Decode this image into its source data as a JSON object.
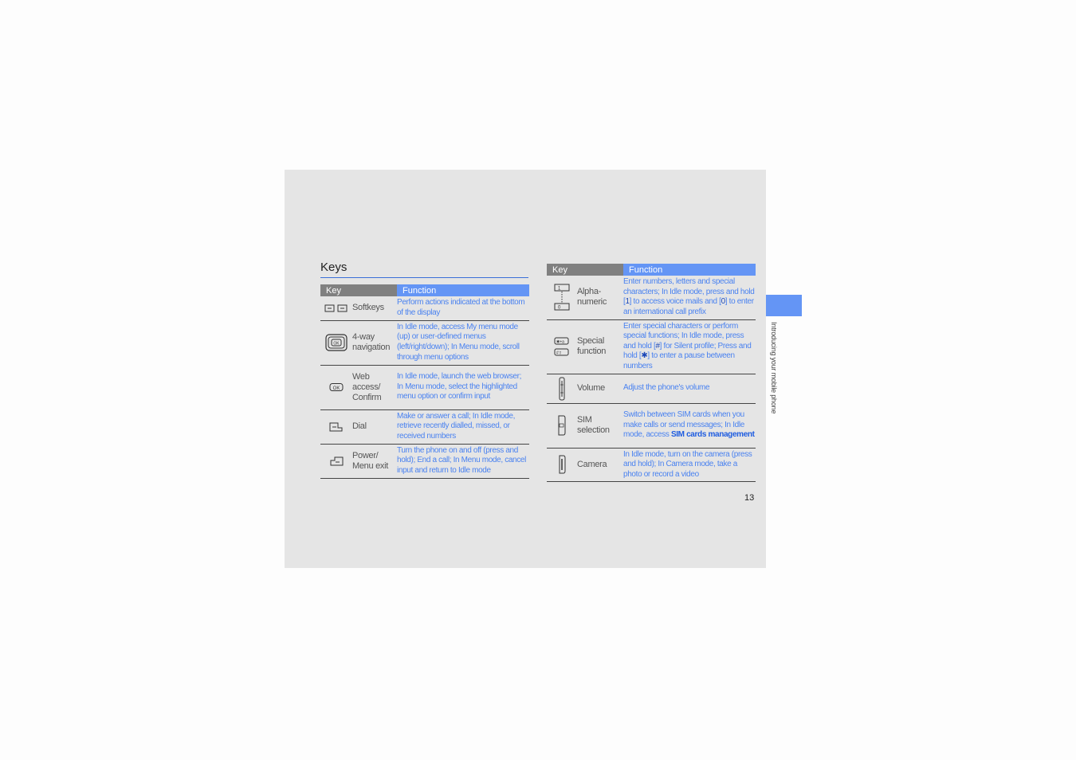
{
  "section_title": "Keys",
  "side_tab": {
    "label": "Introducing your mobile phone",
    "color": "#6495f5"
  },
  "page_number": "13",
  "header": {
    "key": "Key",
    "function": "Function"
  },
  "left_table": [
    {
      "icon": "softkeys-icon",
      "name": "Softkeys",
      "function": "Perform actions indicated at the bottom of the display"
    },
    {
      "icon": "nav-key-icon",
      "name": "4-way navigation",
      "function": "In Idle mode, access My menu mode (up) or user-defined menus (left/right/down); In Menu mode, scroll through menu options"
    },
    {
      "icon": "ok-key-icon",
      "name": "Web access/ Confirm",
      "function": "In Idle mode, launch the web browser; In Menu mode, select the highlighted menu option or confirm input"
    },
    {
      "icon": "dial-key-icon",
      "name": "Dial",
      "function": "Make or answer a call; In Idle mode, retrieve recently dialled, missed, or received numbers"
    },
    {
      "icon": "power-key-icon",
      "name": "Power/ Menu exit",
      "function": "Turn the phone on and off (press and hold); End a call; In Menu mode, cancel input and return to Idle mode"
    }
  ],
  "right_table": [
    {
      "icon": "alphanumeric-keys-icon",
      "name": "Alpha- numeric",
      "function": {
        "p1": "Enter numbers, letters and special characters; In Idle mode, press and hold [",
        "k1": "1",
        "p2": "] to access voice mails and [",
        "k2": "0",
        "p3": "] to enter an international call prefix"
      }
    },
    {
      "icon": "special-keys-icon",
      "name": "Special function",
      "function": {
        "p1": "Enter special characters or perform special functions; In Idle mode, press and hold [",
        "k1": "#",
        "p2": "] for Silent profile; Press and hold [",
        "k2": "✱",
        "p3": "] to enter a pause between numbers"
      }
    },
    {
      "icon": "volume-key-icon",
      "name": "Volume",
      "function": "Adjust the phone's volume"
    },
    {
      "icon": "sim-key-icon",
      "name": "SIM selection",
      "function": {
        "p1": "Switch between SIM cards when you make calls or send messages; In Idle mode, access ",
        "bold": "SIM cards management"
      }
    },
    {
      "icon": "camera-key-icon",
      "name": "Camera",
      "function": "In Idle mode, turn on the camera (press and hold); In Camera mode, take a photo or record a video"
    }
  ]
}
